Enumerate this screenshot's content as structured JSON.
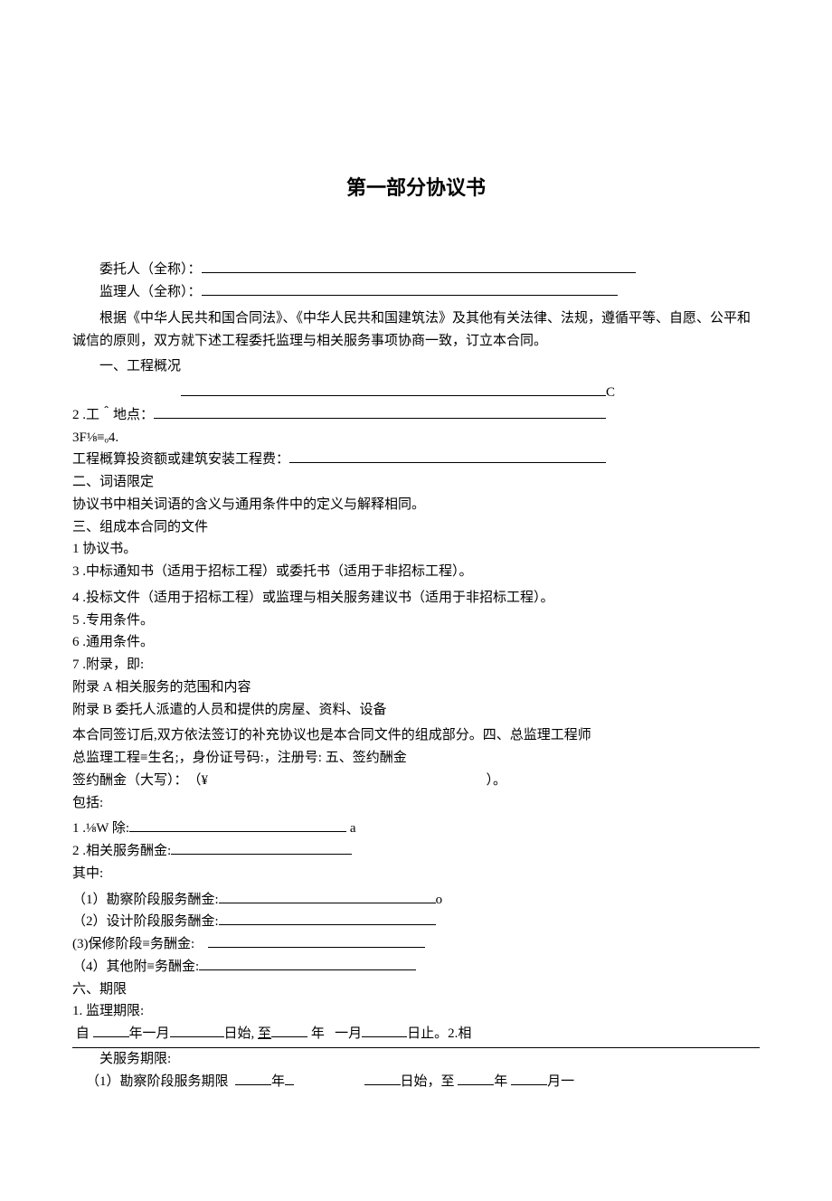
{
  "title": "第一部分协议书",
  "parties": {
    "client_label": "委托人（全称）：",
    "supervisor_label": "监理人（全称）："
  },
  "preamble": "根据《中华人民共和国合同法》、《中华人民共和国建筑法》及其他有关法律、法规，遵循平等、自愿、公平和诚信的原则，双方就下述工程委托监理与相关服务事项协商一致，订立本合同。",
  "s1": {
    "heading": "一、工程概况",
    "trailing": "C",
    "item2": "2 .工＾地点：",
    "item3": "3F⅛≡ₒ4.",
    "item4": "工程概算投资额或建筑安装工程费：",
    "s2h": "二、词语限定",
    "s2p": "协议书中相关词语的含义与通用条件中的定义与解释相同。",
    "s3h": "三、组成本合同的文件",
    "doc1": "1 协议书。",
    "doc3": "3 .中标通知书（适用于招标工程）或委托书（适用于非招标工程）。",
    "doc4": "4 .投标文件（适用于招标工程）或监理与相关服务建议书（适用于非招标工程）。",
    "doc5": "5 .专用条件。",
    "doc6": "6 .通用条件。",
    "doc7": "7 .附录，即:",
    "appA": "附录 A 相关服务的范围和内容",
    "appB": "附录 B 委托人派遣的人员和提供的房屋、资料、设备",
    "after": "本合同签订后,双方依法签订的补充协议也是本合同文件的组成部分。四、总监理工程师",
    "chief": "总监理工程≡生名;，身份证号码:，注册号: 五、签约酬金",
    "fee_label_pre": "签约酬金（大写）：　（¥",
    "fee_label_post": "）。",
    "include": "包括:"
  },
  "fees": {
    "f1_pre": "1 .⅛W 除:",
    "f1_suffix": "a",
    "f2": "2 .相关服务酬金:",
    "wherein": "其中:",
    "p1_pre": "（1）勘察阶段服务酬金:",
    "p1_suffix": "o",
    "p2": "（2）设计阶段服务酬金:",
    "p3": "(3)保修阶段≡务酬金:",
    "p4": "（4）其他附≡务酬金:"
  },
  "term": {
    "h6": "六、期限",
    "l1": "1. 监理期限:",
    "l2_pre": "自",
    "l2_year": "年一月",
    "l2_daystart": "日始,",
    "l2_to": "至",
    "l2_year2": "年",
    "l2_month2": "一月",
    "l2_dayend": "日止。2.相",
    "l3": "关服务期限:",
    "l4_pre": "（1）勘察阶段服务期限",
    "l4_year": "年",
    "l4_daystart": "日始，至",
    "l4_year2": "年",
    "l4_month2": "月一"
  }
}
